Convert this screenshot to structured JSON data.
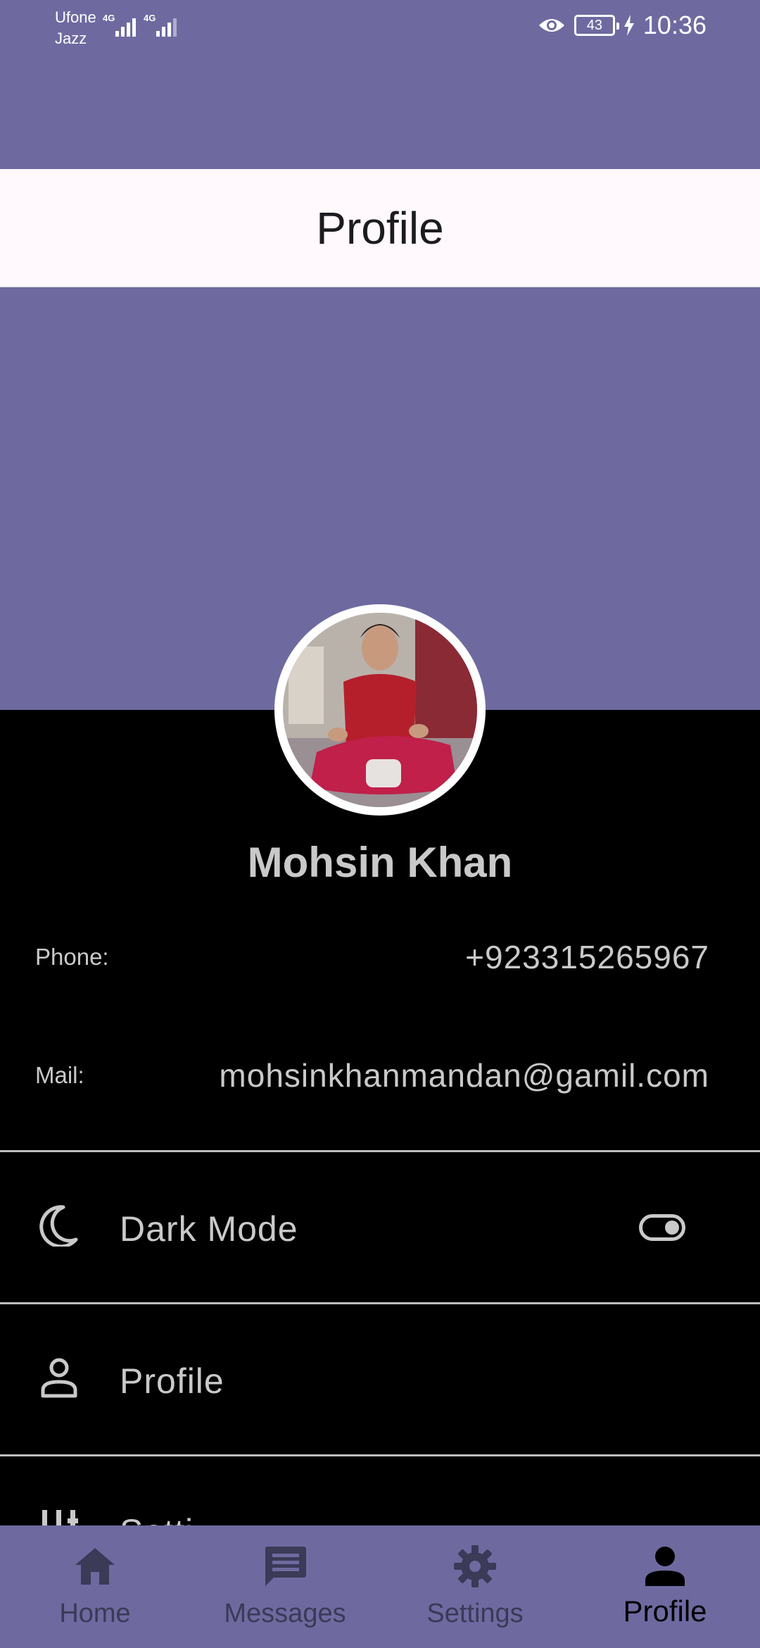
{
  "status_bar": {
    "carrier_1": "Ufone",
    "carrier_2": "Jazz",
    "network_1": "4G",
    "network_2": "4G",
    "battery": "43",
    "time": "10:36"
  },
  "app_bar": {
    "title": "Profile"
  },
  "profile": {
    "name": "Mohsin Khan",
    "phone_label": "Phone:",
    "phone_value": "+923315265967",
    "mail_label": "Mail:",
    "mail_value": "mohsinkhanmandan@gamil.com"
  },
  "menu": [
    {
      "label": "Dark  Mode",
      "icon": "moon-icon",
      "toggle_on": true
    },
    {
      "label": "Profile",
      "icon": "person-outline-icon"
    },
    {
      "label": "Setti",
      "icon": "sliders-icon"
    }
  ],
  "bottom_nav": [
    {
      "label": "Home",
      "icon": "home-icon",
      "active": false
    },
    {
      "label": "Messages",
      "icon": "message-icon",
      "active": false
    },
    {
      "label": "Settings",
      "icon": "gear-icon",
      "active": false
    },
    {
      "label": "Profile",
      "icon": "person-icon",
      "active": true
    }
  ],
  "colors": {
    "accent": "#6e6aa0",
    "app_bar": "#fff8fd",
    "background": "#000000",
    "text": "#c9c9c9",
    "nav_inactive": "#3b3a57"
  }
}
